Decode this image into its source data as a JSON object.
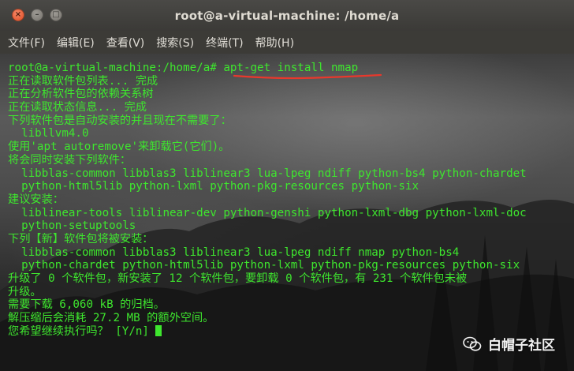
{
  "window": {
    "title": "root@a-virtual-machine: /home/a"
  },
  "menubar": [
    {
      "label": "文件(F)"
    },
    {
      "label": "编辑(E)"
    },
    {
      "label": "查看(V)"
    },
    {
      "label": "搜索(S)"
    },
    {
      "label": "终端(T)"
    },
    {
      "label": "帮助(H)"
    }
  ],
  "terminal": {
    "prompt": "root@a-virtual-machine:/home/a#",
    "command": "apt-get install nmap",
    "lines": [
      "正在读取软件包列表... 完成",
      "正在分析软件包的依赖关系树",
      "正在读取状态信息... 完成",
      "下列软件包是自动安装的并且现在不需要了：",
      "  libllvm4.0",
      "使用'apt autoremove'来卸载它(它们)。",
      "将会同时安装下列软件：",
      "  libblas-common libblas3 liblinear3 lua-lpeg ndiff python-bs4 python-chardet",
      "  python-html5lib python-lxml python-pkg-resources python-six",
      "建议安装：",
      "  liblinear-tools liblinear-dev python-genshi python-lxml-dbg python-lxml-doc",
      "  python-setuptools",
      "下列【新】软件包将被安装：",
      "  libblas-common libblas3 liblinear3 lua-lpeg ndiff nmap python-bs4",
      "  python-chardet python-html5lib python-lxml python-pkg-resources python-six",
      "升级了 0 个软件包，新安装了 12 个软件包，要卸载 0 个软件包，有 231 个软件包未被",
      "升级。",
      "需要下载 6,060 kB 的归档。",
      "解压缩后会消耗 27.2 MB 的额外空间。"
    ],
    "final_prompt": "您希望继续执行吗？ [Y/n] "
  },
  "watermark": {
    "text": "白帽子社区",
    "icon": "wechat-icon"
  },
  "colors": {
    "terminal_text": "#3ee62e",
    "annotation": "#e8382c",
    "titlebar": "#3c3b37"
  }
}
